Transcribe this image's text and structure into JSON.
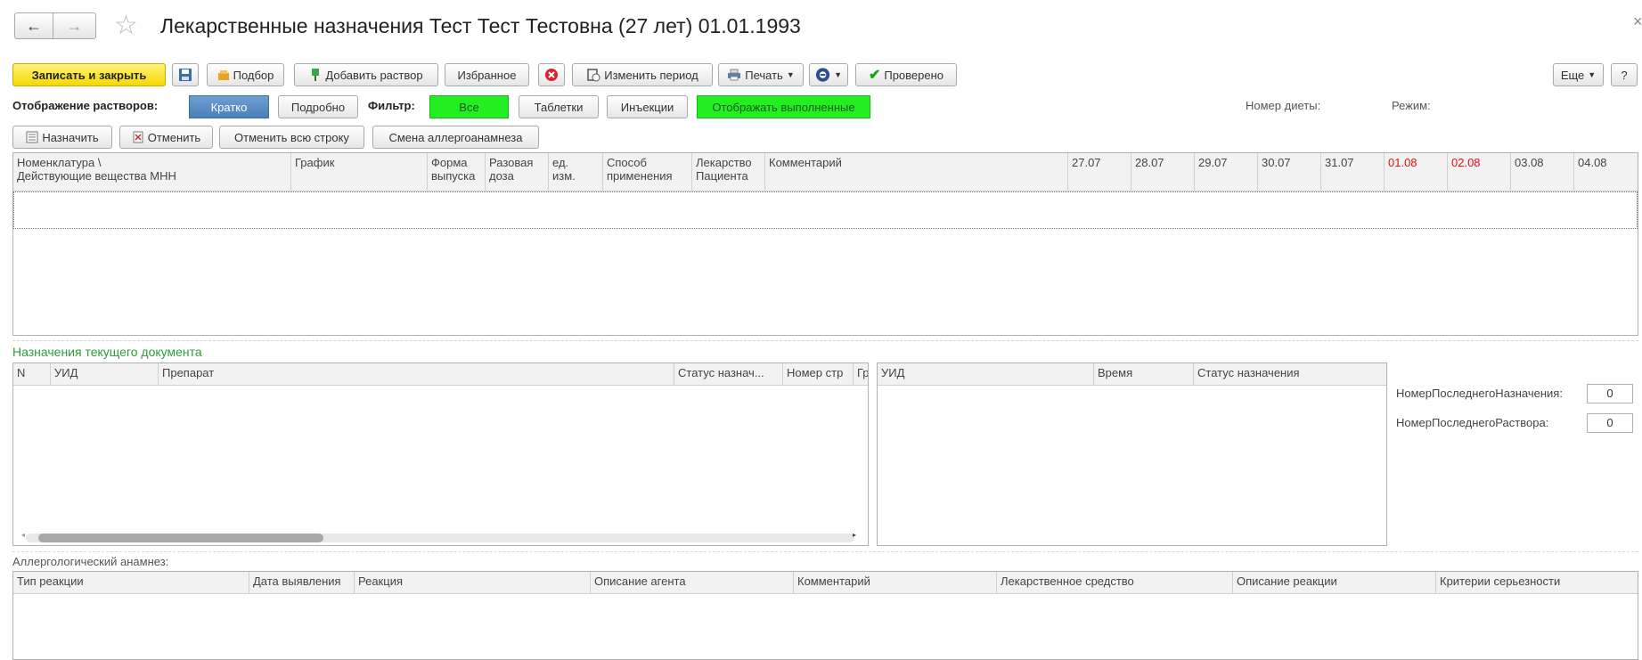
{
  "header": {
    "back_label": "←",
    "forward_label": "→",
    "star_label": "☆",
    "title": "Лекарственные назначения Тест Тест Тестовна (27 лет) 01.01.1993",
    "close_label": "×"
  },
  "toolbar": {
    "save_close": "Записать и закрыть",
    "pick": "Подбор",
    "add_solution": "Добавить раствор",
    "favorites": "Избранное",
    "change_period": "Изменить период",
    "print": "Печать",
    "checked": "Проверено",
    "more": "Еще",
    "help": "?"
  },
  "display_bar": {
    "solutions_label": "Отображение растворов:",
    "brief": "Кратко",
    "detailed": "Подробно",
    "filter_label": "Фильтр:",
    "all": "Все",
    "tablets": "Таблетки",
    "injections": "Инъекции",
    "show_done": "Отображать выполненные",
    "diet_label": "Номер диеты:",
    "mode_label": "Режим:"
  },
  "actions": {
    "assign": "Назначить",
    "cancel": "Отменить",
    "cancel_row": "Отменить всю строку",
    "allergy_change": "Смена аллергоанамнеза"
  },
  "main_table": {
    "headers": [
      "Номенклатура \\\nДействующие вещества МНН",
      "График",
      "Форма\nвыпуска",
      "Разовая\nдоза",
      "ед.\nизм.",
      "Способ\nприменения",
      "Лекарство\nПациента",
      "Комментарий"
    ],
    "dates": [
      "27.07",
      "28.07",
      "29.07",
      "30.07",
      "31.07",
      "01.08",
      "02.08",
      "03.08",
      "04.08"
    ],
    "weekend_color": "#e0101a"
  },
  "current_doc": {
    "title": "Назначения текущего документа",
    "title_color": "#2e9c3a",
    "headers": [
      "N",
      "УИД",
      "Препарат",
      "Статус назнач...",
      "Номер стр",
      "Граф"
    ]
  },
  "details_table": {
    "headers": [
      "УИД",
      "Время",
      "Статус назначения"
    ]
  },
  "counters": {
    "last_assign_label": "НомерПоследнегоНазначения:",
    "last_assign_value": "0",
    "last_solution_label": "НомерПоследнегоРаствора:",
    "last_solution_value": "0"
  },
  "allergy": {
    "title": "Аллергологический анамнез:",
    "headers": [
      "Тип реакции",
      "Дата выявления",
      "Реакция",
      "Описание агента",
      "Комментарий",
      "Лекарственное средство",
      "Описание реакции",
      "Критерии серьезности"
    ]
  }
}
